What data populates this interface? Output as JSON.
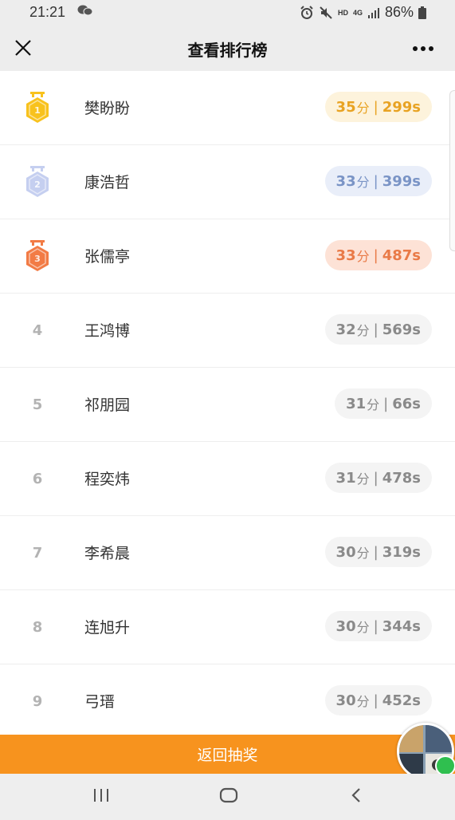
{
  "status_bar": {
    "time": "21:21",
    "battery": "86%",
    "hd_label": "HD",
    "net_label": "4G"
  },
  "nav": {
    "title": "查看排行榜"
  },
  "leaderboard": [
    {
      "rank": "1",
      "name": "樊盼盼",
      "score": "35",
      "unit": "分",
      "time": "299s",
      "style": "gold"
    },
    {
      "rank": "2",
      "name": "康浩哲",
      "score": "33",
      "unit": "分",
      "time": "399s",
      "style": "silver"
    },
    {
      "rank": "3",
      "name": "张儒亭",
      "score": "33",
      "unit": "分",
      "time": "487s",
      "style": "bronze"
    },
    {
      "rank": "4",
      "name": "王鸿博",
      "score": "32",
      "unit": "分",
      "time": "569s",
      "style": "plain"
    },
    {
      "rank": "5",
      "name": "祁朋园",
      "score": "31",
      "unit": "分",
      "time": "66s",
      "style": "plain"
    },
    {
      "rank": "6",
      "name": "程奕炜",
      "score": "31",
      "unit": "分",
      "time": "478s",
      "style": "plain"
    },
    {
      "rank": "7",
      "name": "李希晨",
      "score": "30",
      "unit": "分",
      "time": "319s",
      "style": "plain"
    },
    {
      "rank": "8",
      "name": "连旭升",
      "score": "30",
      "unit": "分",
      "time": "344s",
      "style": "plain"
    },
    {
      "rank": "9",
      "name": "弓瑨",
      "score": "30",
      "unit": "分",
      "time": "452s",
      "style": "plain"
    }
  ],
  "medal_colors": {
    "gold": "#f8c21d",
    "silver": "#c5cff0",
    "bronze": "#f27b45"
  },
  "bottom_button": {
    "label": "返回抽奖"
  },
  "accent_color": "#f7931e"
}
